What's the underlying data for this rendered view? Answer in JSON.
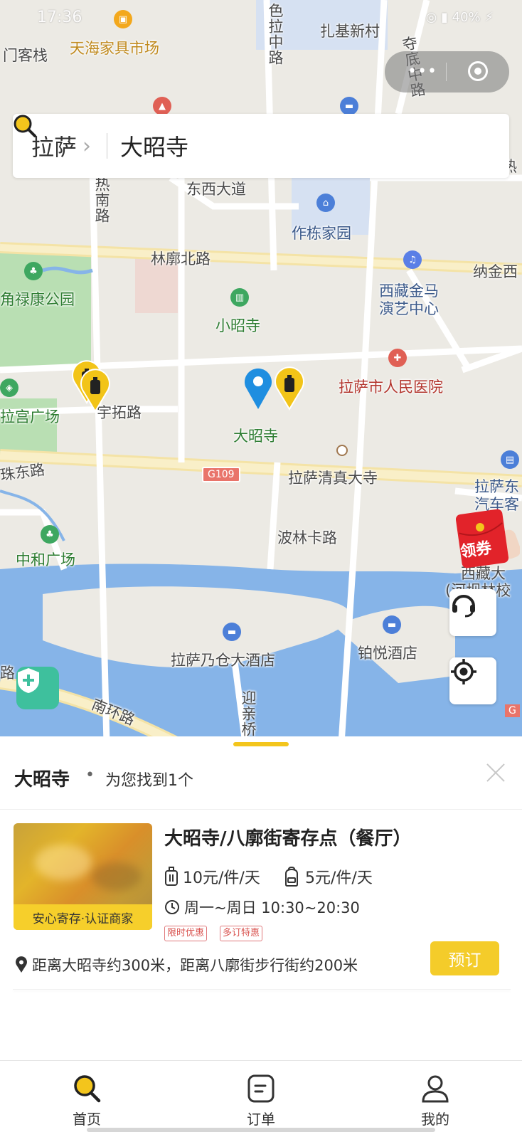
{
  "status_bar": {
    "time": "17:36",
    "right": "◎ ▮ 40% ⚡"
  },
  "search": {
    "city": "拉萨",
    "query": "大昭寺"
  },
  "map": {
    "labels": {
      "tianhai": "天海家具市场",
      "menkezhan": "门客栈",
      "zhaji": "扎基新村",
      "sela": "色拉中路",
      "duodi": "夺底中路",
      "re_top": "热",
      "dongxi": "东西大道",
      "zuodong": "作栋家园",
      "renan": "热南路",
      "linkuobei": "林廓北路",
      "najin": "纳金西",
      "jiaolu": "角禄康公园",
      "xiaozhao": "小昭寺",
      "xizang_jinma": "西藏金马",
      "yanyi": "演艺中心",
      "renmin": "拉萨市人民医院",
      "yutuo": "宇拓路",
      "gongguang": "拉宫广场",
      "dazhao": "大昭寺",
      "zhudong": "珠东路",
      "g109": "G109",
      "qingzhen": "拉萨清真大寺",
      "lasadong1": "拉萨东",
      "lasadong2": "汽车客",
      "zhonghe": "中和广场",
      "bolinka": "波林卡路",
      "xizangda": "西藏大",
      "hebalin": "(河坝林校",
      "nawcang": "拉萨乃仓大酒店",
      "boyue": "铂悦酒店",
      "yingqin": "迎亲桥",
      "nanhuan": "南环路",
      "lu": "路",
      "gtag": "G"
    },
    "coupon_label": "领券"
  },
  "sheet": {
    "title": "大昭寺",
    "dot": "•",
    "count_text": "为您找到1个"
  },
  "result": {
    "name": "大昭寺/八廓街寄存点（餐厅）",
    "price_large": "10元/件/天",
    "price_small": "5元/件/天",
    "hours": "周一~周日 10:30~20:30",
    "tags": [
      "限时优惠",
      "多订特惠"
    ],
    "thumb_caption": "安心寄存·认证商家",
    "distance": "距离大昭寺约300米，距离八廓街步行街约200米",
    "book_label": "预订"
  },
  "tabs": [
    {
      "label": "首页",
      "icon": "search-icon"
    },
    {
      "label": "订单",
      "icon": "order-icon"
    },
    {
      "label": "我的",
      "icon": "profile-icon"
    }
  ],
  "colors": {
    "accent": "#f3c51c",
    "water": "#7eaee6",
    "green": "#b7dfb0",
    "road": "#f6e8b4"
  }
}
